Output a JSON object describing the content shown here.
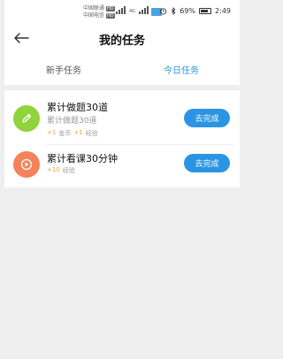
{
  "status_bar": {
    "carrier_1": "中国联通",
    "carrier_2": "中国电信",
    "hd_badge": "HD",
    "network": "4G",
    "battery_percent": "69%",
    "time": "2:49"
  },
  "header": {
    "title": "我的任务",
    "back_icon": "arrow-left-icon"
  },
  "tabs": [
    {
      "label": "新手任务",
      "active": false
    },
    {
      "label": "今日任务",
      "active": true
    }
  ],
  "tasks": [
    {
      "icon": "pencil-icon",
      "icon_color": "#8fd43a",
      "title": "累计做题30道",
      "subtitle": "累计做题30道",
      "reward_1_num": "+1",
      "reward_1_label": "金币",
      "reward_2_num": "+1",
      "reward_2_label": "经验",
      "button": "去完成"
    },
    {
      "icon": "play-icon",
      "icon_color": "#f4825a",
      "title": "累计看课30分钟",
      "reward_1_num": "+10",
      "reward_1_label": "经验",
      "button": "去完成"
    }
  ],
  "colors": {
    "accent": "#2c95e3",
    "reward": "#f2a03b",
    "background": "#efefef"
  }
}
